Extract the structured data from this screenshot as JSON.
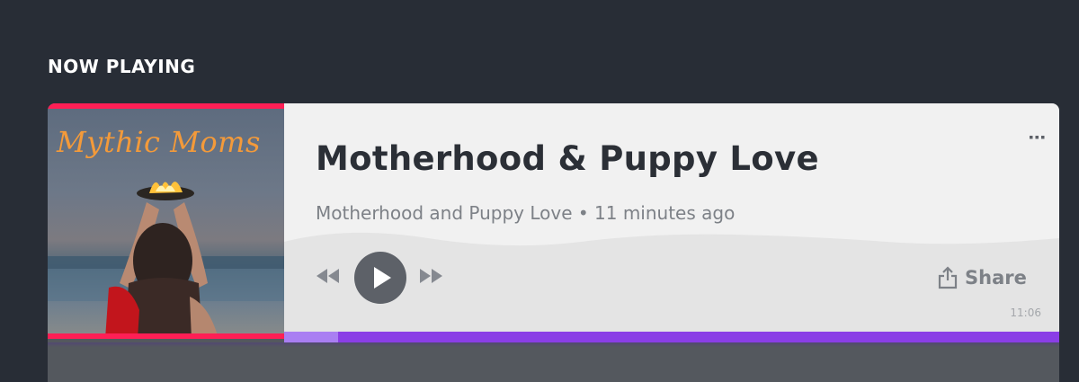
{
  "section": {
    "title": "NOW PLAYING"
  },
  "episode": {
    "title": "Motherhood & Puppy Love",
    "meta": "Motherhood and Puppy Love • 11 minutes ago",
    "duration": "11:06",
    "progress_fraction": 0.07
  },
  "artwork": {
    "title_text": "Mythic Moms"
  },
  "controls": {
    "share_label": "Share",
    "rewind_icon": "rewind-icon",
    "play_icon": "play-icon",
    "forward_icon": "fast-forward-icon",
    "more_icon": "more-options-icon",
    "share_icon": "share-icon"
  },
  "colors": {
    "background": "#282d36",
    "card": "#f1f1f1",
    "accent_pink": "#ff1f55",
    "progress_track": "#8a3ee6",
    "progress_fill": "#a97ef2"
  }
}
